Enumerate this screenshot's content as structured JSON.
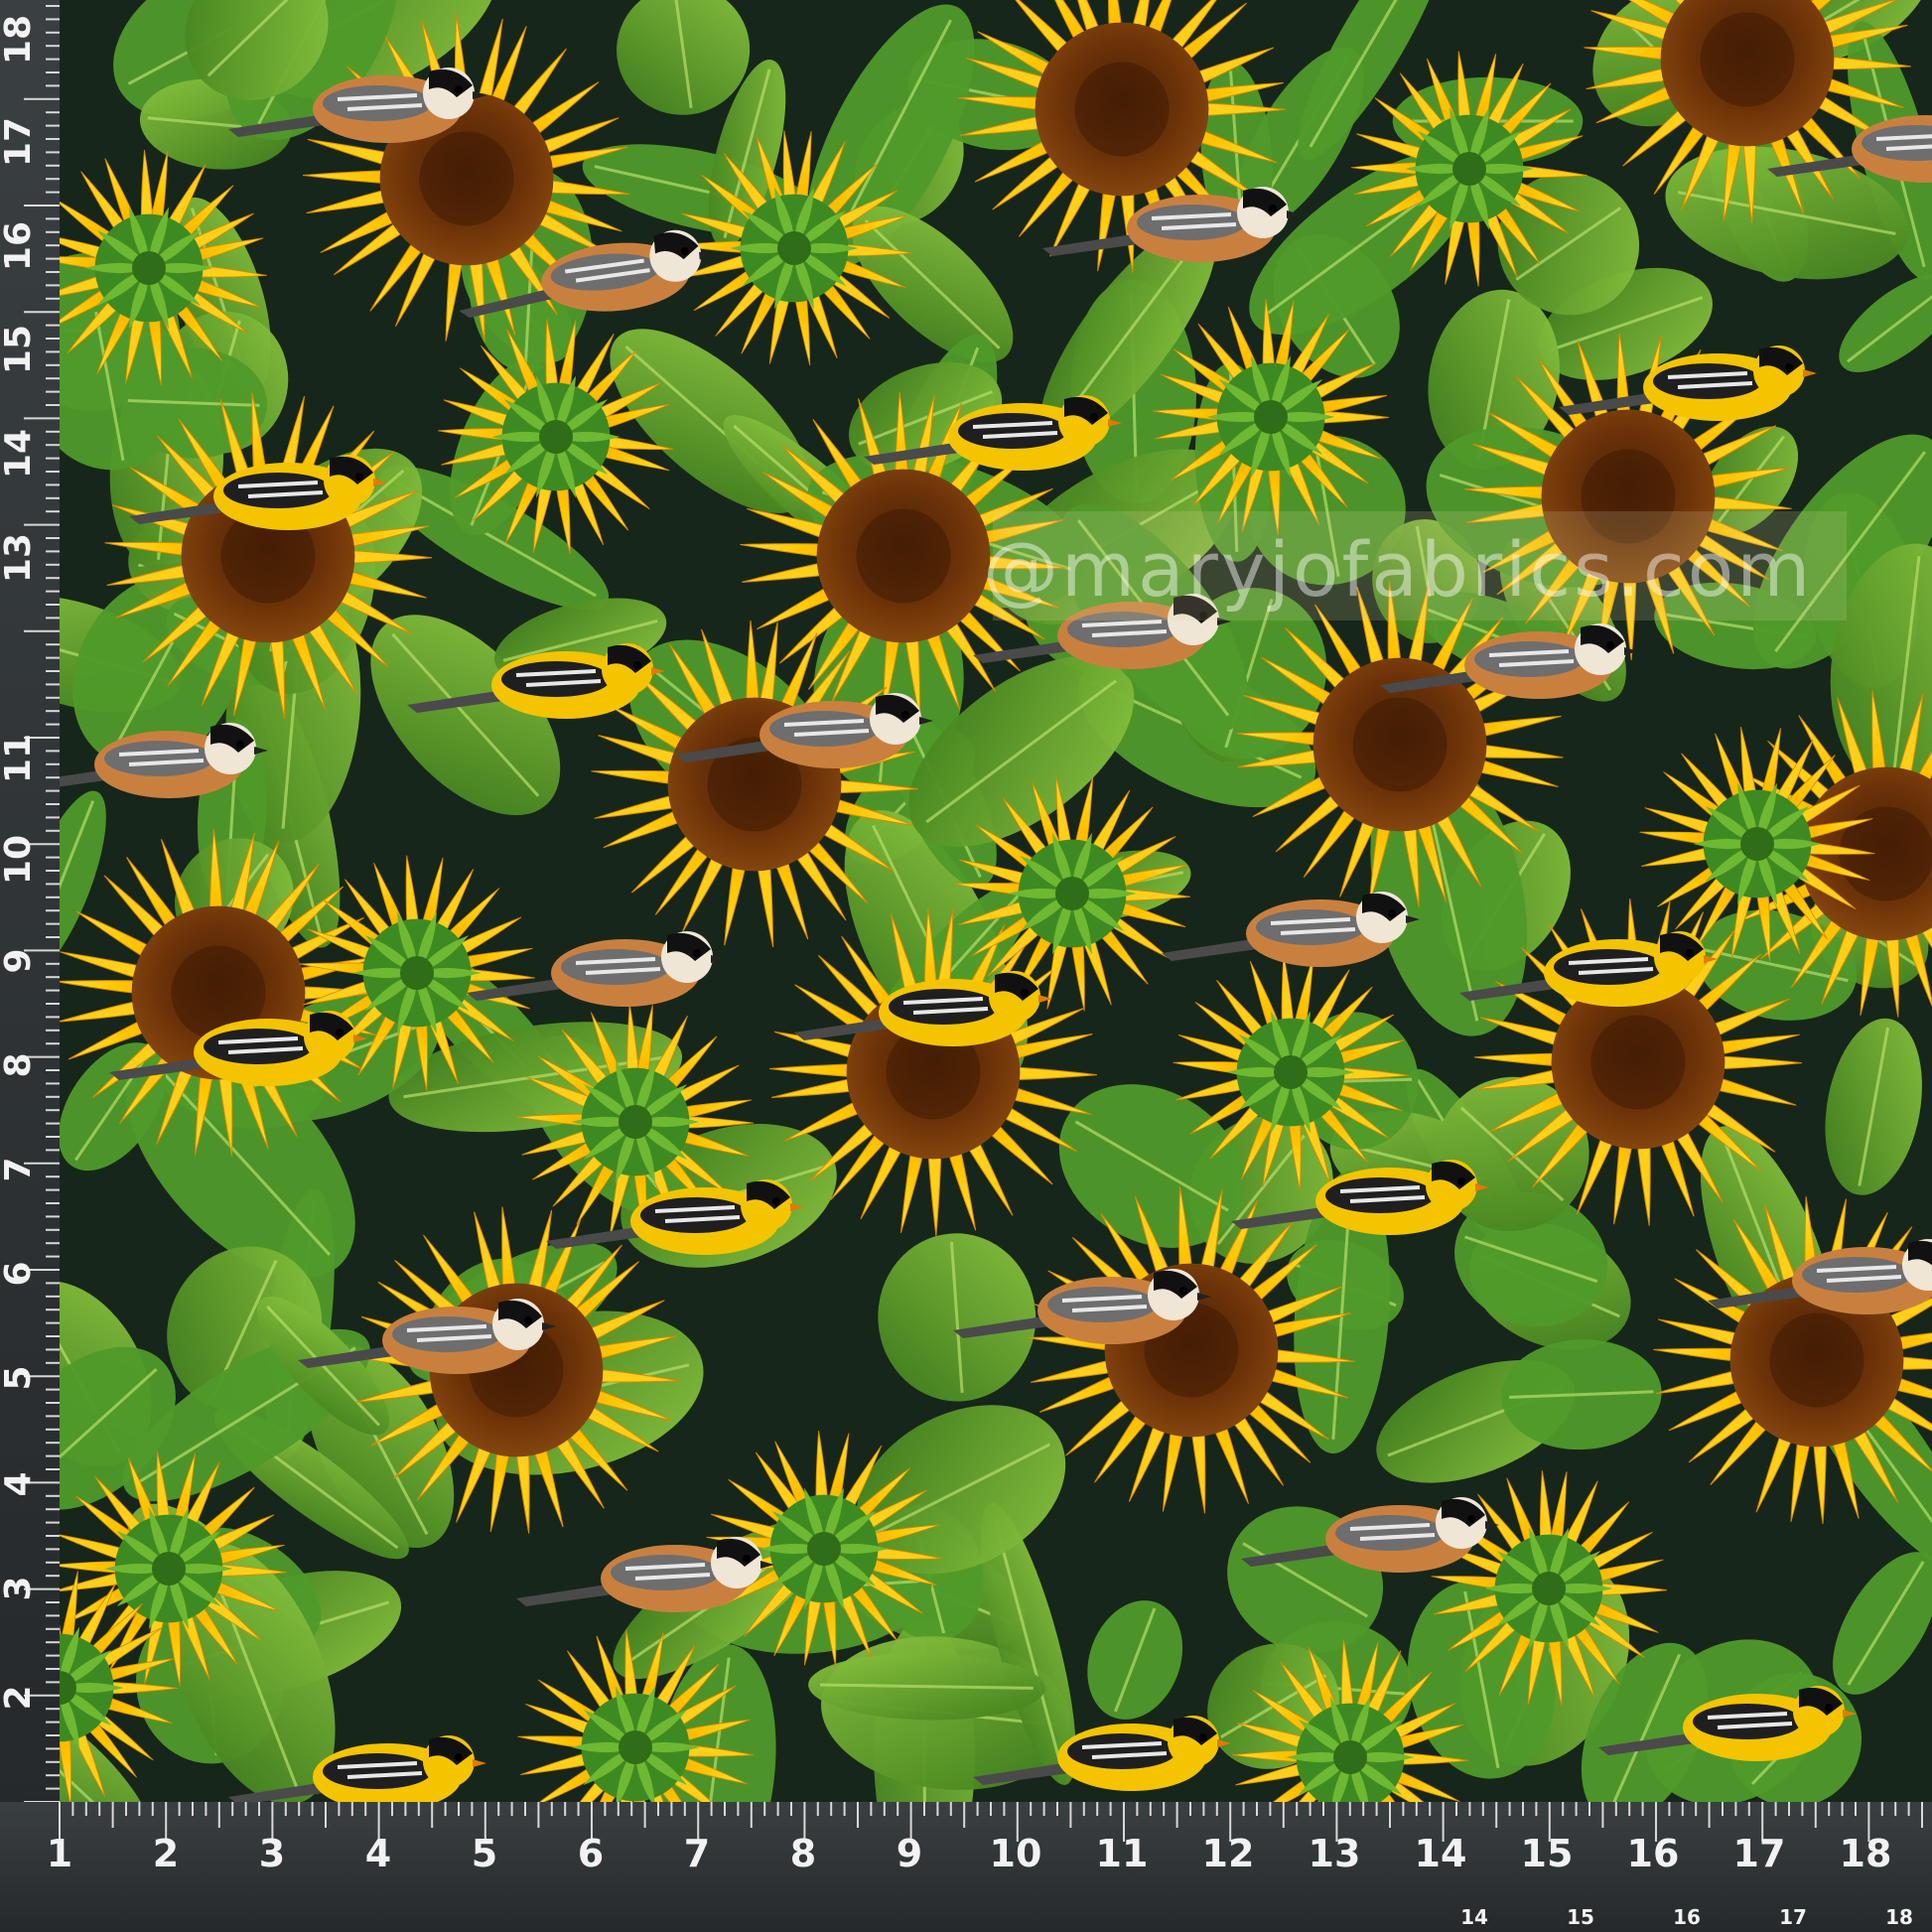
{
  "watermark": "@maryjofabrics.com",
  "ruler_bottom": [
    "1",
    "2",
    "3",
    "4",
    "5",
    "6",
    "7",
    "8",
    "9",
    "10",
    "11",
    "12",
    "13",
    "14",
    "15",
    "16",
    "17",
    "18"
  ],
  "ruler_bottom_small": [
    "14",
    "15",
    "16",
    "17",
    "18"
  ],
  "ruler_left": [
    "2",
    "3",
    "4",
    "5",
    "6",
    "7",
    "8",
    "9",
    "10",
    "11",
    "13",
    "14",
    "15",
    "16",
    "17",
    "18"
  ],
  "colors": {
    "background": "#17261a",
    "leaf": "#4f9a2a",
    "leaf_light": "#8cc63f",
    "petal": "#f5b800",
    "petal_light": "#ffd21a",
    "center": "#6b3208",
    "ruler": "#2e3335",
    "ruler_text": "#f2f2f2"
  }
}
